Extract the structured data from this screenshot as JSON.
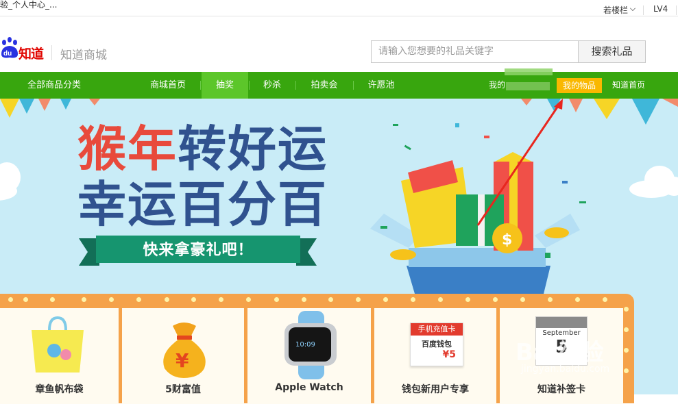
{
  "window": {
    "title": "验_个人中心_..."
  },
  "user_bar": {
    "username": "若楼栏",
    "level": "LV4"
  },
  "header": {
    "logo_text": "知道",
    "mall_name": "知道商城",
    "search_placeholder": "请输入您想要的礼品关键字",
    "search_button": "搜索礼品"
  },
  "nav": {
    "all_categories": "全部商品分类",
    "items": [
      {
        "label": "商城首页"
      },
      {
        "label": "抽奖"
      },
      {
        "label": "秒杀"
      },
      {
        "label": "拍卖会"
      },
      {
        "label": "许愿池"
      }
    ],
    "my_prefix": "我的",
    "my_items": "我的物品",
    "zhidao_home": "知道首页"
  },
  "banner": {
    "line1_red": "猴年",
    "line1_blue": "转好运",
    "line2": "幸运百分百",
    "ribbon": "快来拿豪礼吧！"
  },
  "products": [
    {
      "name": "章鱼帆布袋"
    },
    {
      "name": "5财富值"
    },
    {
      "name": "Apple Watch"
    },
    {
      "name": "钱包新用户专享",
      "card_top": "手机充值卡",
      "card_brand": "百度钱包",
      "card_value": "¥5"
    },
    {
      "name": "知道补签卡",
      "calendar_month": "September",
      "calendar_day": "5"
    }
  ],
  "watermark": {
    "main": "Bai经验",
    "sub": "jingyan.baidu.com"
  },
  "colors": {
    "nav_green": "#38a60e",
    "nav_active": "#5cc62a",
    "accent_orange": "#f9b800",
    "banner_bg": "#c9ecf7"
  }
}
